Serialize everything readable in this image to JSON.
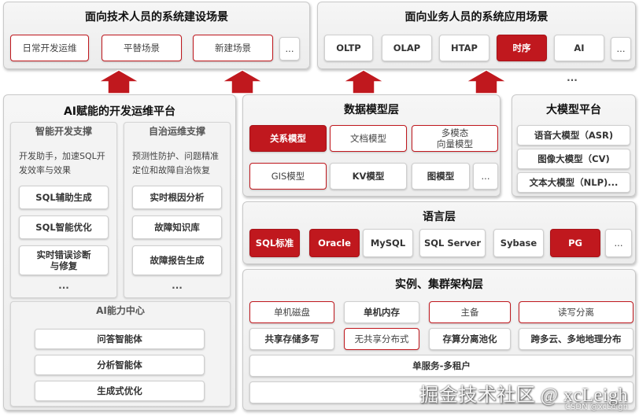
{
  "colors": {
    "accent": "#c0181e",
    "panel": "#efefef",
    "border": "#c9c9c9"
  },
  "tech_scenarios": {
    "title": "面向技术人员的系统建设场景",
    "items": [
      "日常开发运维",
      "平替场景",
      "新建场景"
    ],
    "more": "..."
  },
  "biz_scenarios": {
    "title": "面向业务人员的系统应用场景",
    "items": [
      "OLTP",
      "OLAP",
      "HTAP",
      "时序",
      "AI"
    ],
    "more": "...",
    "ellipsis": "..."
  },
  "ai_ops": {
    "title": "AI赋能的开发运维平台",
    "dev": {
      "title": "智能开发支撑",
      "desc": "开发助手，加速SQL开发效率与效果",
      "items": [
        "SQL辅助生成",
        "SQL智能优化",
        "实时错误诊断\n与修复"
      ],
      "more": "..."
    },
    "ops": {
      "title": "自治运维支撑",
      "desc": "预测性防护、问题精准定位和故障自治恢复",
      "items": [
        "实时根因分析",
        "故障知识库",
        "故障报告生成"
      ],
      "more": "..."
    },
    "center": {
      "title": "AI能力中心",
      "items": [
        "问答智能体",
        "分析智能体",
        "生成式优化"
      ]
    }
  },
  "data_model": {
    "title": "数据模型层",
    "row1": [
      "关系模型",
      "文档模型",
      "多模态\n向量模型"
    ],
    "row2": [
      "GIS模型",
      "KV模型",
      "图模型"
    ],
    "more": "..."
  },
  "llm_platform": {
    "title": "大模型平台",
    "items": [
      "语音大模型（ASR)",
      "图像大模型（CV)",
      "文本大模型（NLP)..."
    ]
  },
  "language": {
    "title": "语言层",
    "items": [
      "SQL标准",
      "Oracle",
      "MySQL",
      "SQL Server",
      "Sybase",
      "PG"
    ],
    "more": "..."
  },
  "instance": {
    "title": "实例、集群架构层",
    "row1": [
      "单机磁盘",
      "单机内存",
      "主备",
      "读写分离"
    ],
    "row2": [
      "共享存储多写",
      "无共享分布式",
      "存算分离池化",
      "跨多云、多地地理分布"
    ],
    "row3": "单服务-多租户"
  },
  "watermark": {
    "main": "掘金技术社区 @ xcLeigh",
    "small": "CSDN @xcLeigh"
  }
}
